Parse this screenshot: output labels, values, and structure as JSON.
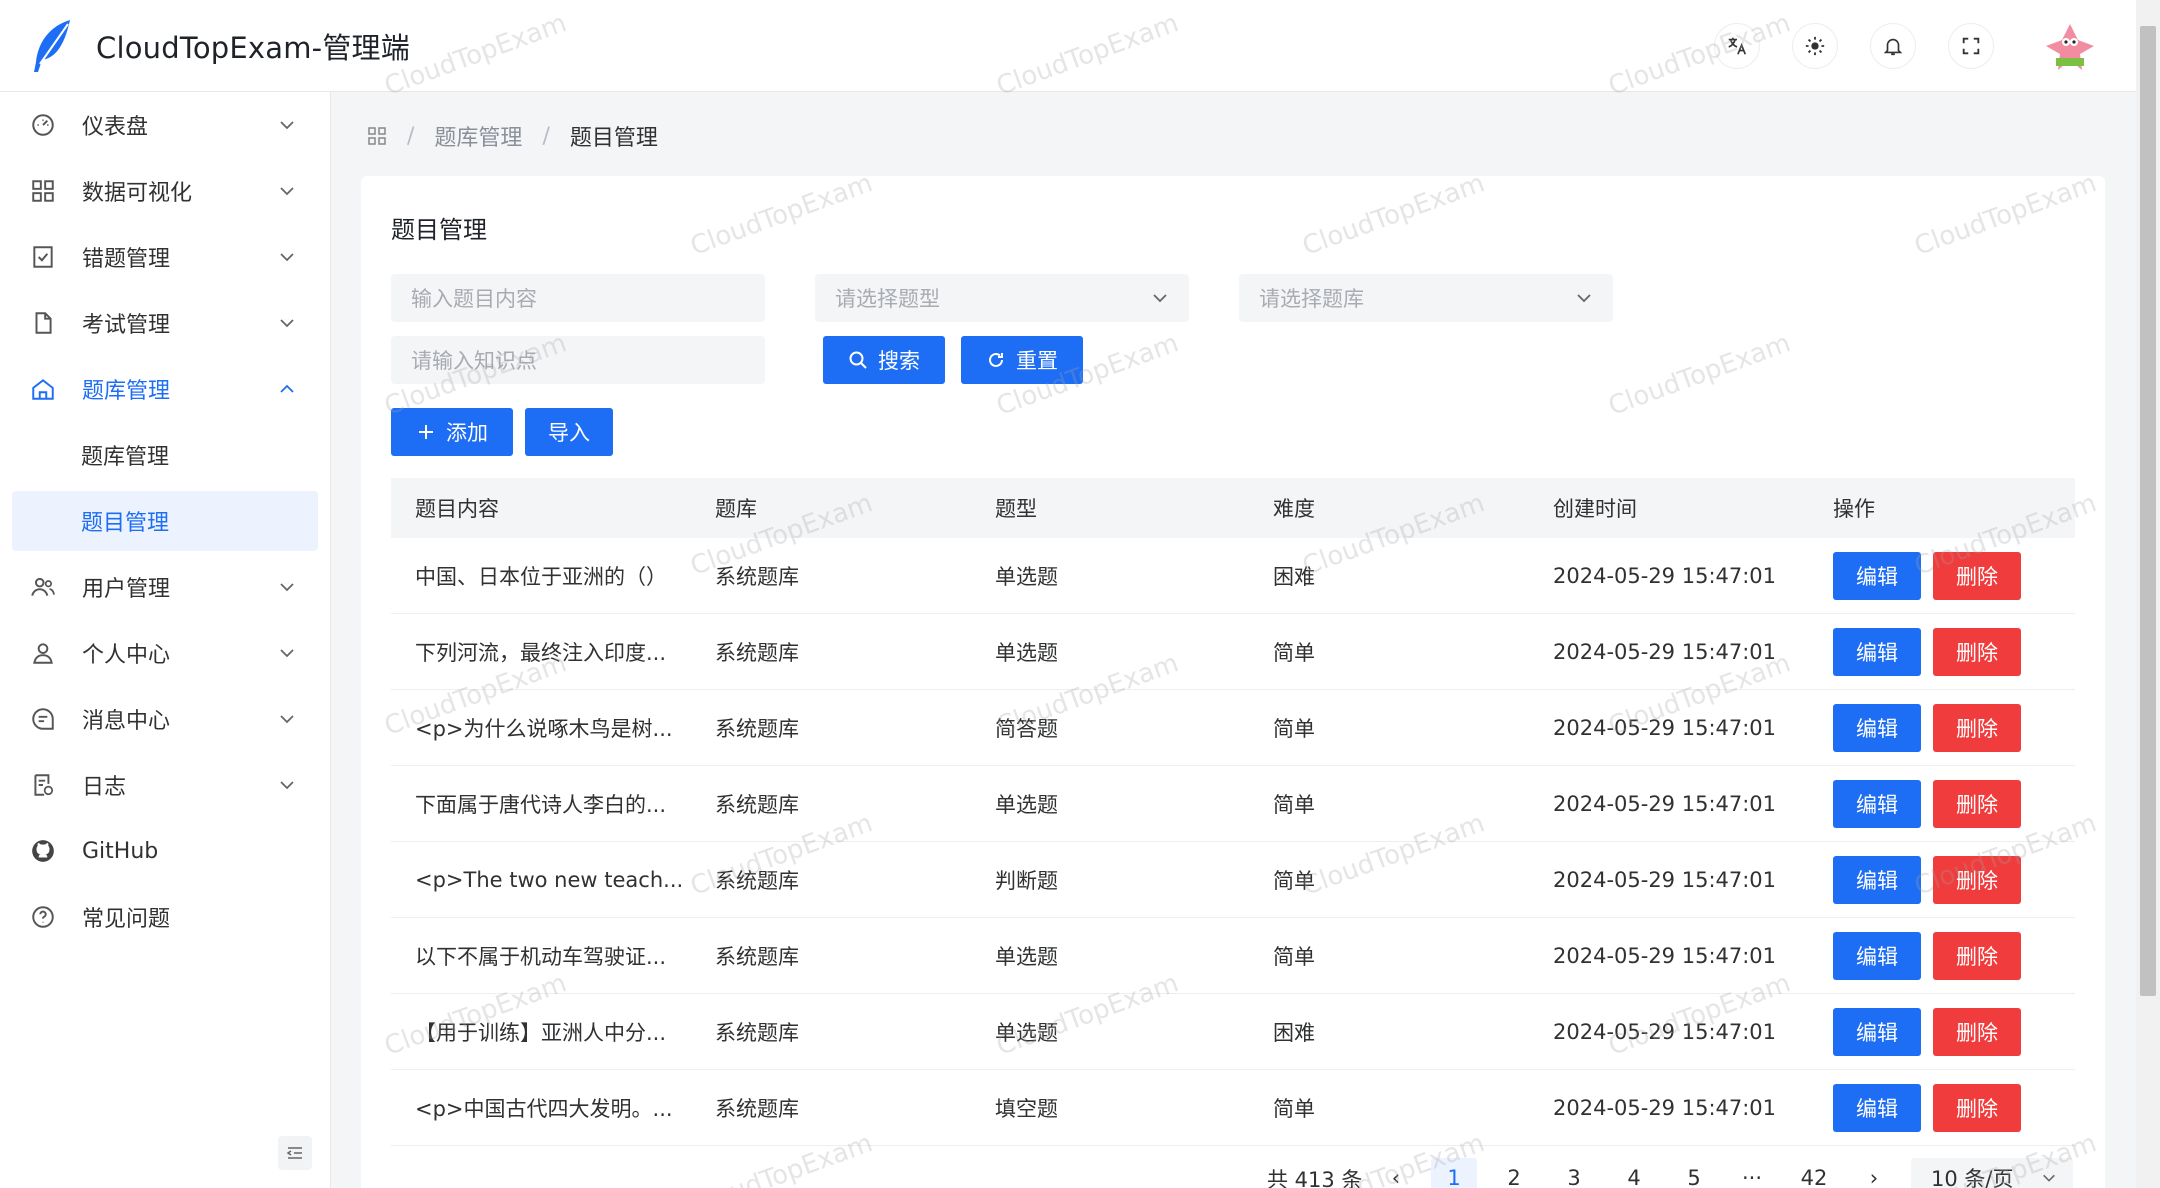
{
  "app": {
    "title": "CloudTopExam-管理端",
    "brand_color": "#1e6ef5",
    "danger_color": "#f03c3c"
  },
  "header": {
    "icons": [
      "translate-icon",
      "theme-icon",
      "notification-bell-icon",
      "fullscreen-icon"
    ],
    "avatar": "user-avatar"
  },
  "sidebar": {
    "items": [
      {
        "label": "仪表盘",
        "icon": "dashboard-icon",
        "expanded": false
      },
      {
        "label": "数据可视化",
        "icon": "grid-icon",
        "expanded": false
      },
      {
        "label": "错题管理",
        "icon": "bookmark-check-icon",
        "expanded": false
      },
      {
        "label": "考试管理",
        "icon": "document-icon",
        "expanded": false
      },
      {
        "label": "题库管理",
        "icon": "home-icon",
        "expanded": true,
        "children": [
          {
            "label": "题库管理"
          },
          {
            "label": "题目管理",
            "active": true
          }
        ]
      },
      {
        "label": "用户管理",
        "icon": "users-icon",
        "expanded": false
      },
      {
        "label": "个人中心",
        "icon": "user-icon",
        "expanded": false
      },
      {
        "label": "消息中心",
        "icon": "message-icon",
        "expanded": false
      },
      {
        "label": "日志",
        "icon": "log-icon",
        "expanded": false
      },
      {
        "label": "GitHub",
        "icon": "github-icon"
      },
      {
        "label": "常见问题",
        "icon": "help-icon"
      }
    ]
  },
  "breadcrumb": {
    "items": [
      "题库管理",
      "题目管理"
    ]
  },
  "page": {
    "title": "题目管理"
  },
  "filters": {
    "content_placeholder": "输入题目内容",
    "type_placeholder": "请选择题型",
    "repo_placeholder": "请选择题库",
    "knowledge_placeholder": "请输入知识点",
    "search_label": "搜索",
    "reset_label": "重置",
    "add_label": "添加",
    "import_label": "导入"
  },
  "table": {
    "columns": [
      "题目内容",
      "题库",
      "题型",
      "难度",
      "创建时间",
      "操作"
    ],
    "edit_label": "编辑",
    "delete_label": "删除",
    "rows": [
      {
        "content": "中国、日本位于亚洲的（）",
        "repo": "系统题库",
        "type": "单选题",
        "difficulty": "困难",
        "created": "2024-05-29 15:47:01"
      },
      {
        "content": "下列河流，最终注入印度...",
        "repo": "系统题库",
        "type": "单选题",
        "difficulty": "简单",
        "created": "2024-05-29 15:47:01"
      },
      {
        "content": "<p>为什么说啄木鸟是树...",
        "repo": "系统题库",
        "type": "简答题",
        "difficulty": "简单",
        "created": "2024-05-29 15:47:01"
      },
      {
        "content": "下面属于唐代诗人李白的...",
        "repo": "系统题库",
        "type": "单选题",
        "difficulty": "简单",
        "created": "2024-05-29 15:47:01"
      },
      {
        "content": "<p>The two new teach...",
        "repo": "系统题库",
        "type": "判断题",
        "difficulty": "简单",
        "created": "2024-05-29 15:47:01"
      },
      {
        "content": "以下不属于机动车驾驶证...",
        "repo": "系统题库",
        "type": "单选题",
        "difficulty": "简单",
        "created": "2024-05-29 15:47:01"
      },
      {
        "content": "【用于训练】亚洲人中分...",
        "repo": "系统题库",
        "type": "单选题",
        "difficulty": "困难",
        "created": "2024-05-29 15:47:01"
      },
      {
        "content": "<p>中国古代四大发明。...",
        "repo": "系统题库",
        "type": "填空题",
        "difficulty": "简单",
        "created": "2024-05-29 15:47:01"
      }
    ]
  },
  "pagination": {
    "total": "共 413 条",
    "pages": [
      "1",
      "2",
      "3",
      "4",
      "5"
    ],
    "ellipsis": "···",
    "last": "42",
    "current": "1",
    "page_size": "10 条/页",
    "prev": "‹",
    "next": "›"
  },
  "watermark": "CloudTopExam"
}
